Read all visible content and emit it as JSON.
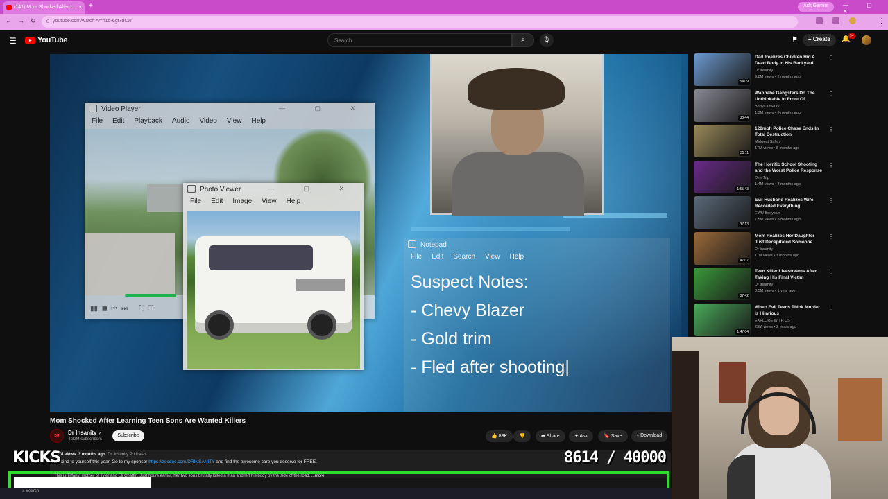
{
  "browser": {
    "tab_title": "(141) Mom Shocked After L...",
    "tab_close": "×",
    "new_tab": "+",
    "url": "youtube.com/watch?v=n15-6gt7dCw",
    "gemini_label": "Ask Gemini",
    "window_controls": "— ▢ ✕"
  },
  "header": {
    "logo_text": "YouTube",
    "search_placeholder": "Search",
    "create_label": "+ Create",
    "notif_count": "9+"
  },
  "video_overlay": {
    "video_player": {
      "title": "Video Player",
      "menu": [
        "File",
        "Edit",
        "Playback",
        "Audio",
        "Video",
        "View",
        "Help"
      ]
    },
    "photo_viewer": {
      "title": "Photo Viewer",
      "menu": [
        "File",
        "Edit",
        "Image",
        "View",
        "Help"
      ]
    },
    "notepad": {
      "title": "Notepad",
      "menu": [
        "File",
        "Edit",
        "Search",
        "View",
        "Help"
      ],
      "lines": [
        "Suspect Notes:",
        "- Chevy Blazer",
        "- Gold trim",
        "- Fled after shooting|"
      ]
    }
  },
  "video": {
    "title": "Mom Shocked After Learning Teen Sons Are Wanted Killers",
    "channel": "Dr Insanity",
    "channel_badge": "DR",
    "subscribers": "4.32M subscribers",
    "subscribe_label": "Subscribe",
    "likes": "83K",
    "share_label": "Share",
    "ask_label": "Ask",
    "save_label": "Save",
    "download_label": "Download"
  },
  "description": {
    "meta_views": "7.1M views",
    "meta_age": "3 months ago",
    "meta_tag": "Dr. Insanity Podcasts",
    "line2_text": "Be kind to yourself this year. Go to my sponsor",
    "line2_link": "https://zocdoc.com/DRINSANITY",
    "line2_tail": "and find the awesome care you deserve for FREE.",
    "line3": "This is Tiffany, mother of Tyler and Eli Chaffin. Just hours earlier, her two sons brutally killed a man and left his body by the side of the road.",
    "more": "...more"
  },
  "stream_overlay": {
    "kicks_label": "KICKS",
    "goal_counter": "8614 / 40000"
  },
  "taskbar": {
    "search_text": "Search"
  },
  "recommendations": [
    {
      "title": "Dad Realizes Children Hid A Dead Body In His Backyard",
      "channel": "Dr Insanity",
      "meta": "9.8M views • 2 months ago",
      "duration": "54:09",
      "color": "#6d9bd1"
    },
    {
      "title": "Wannabe Gangsters Do The Unthinkable In Front Of ...",
      "channel": "BodyCamPOV",
      "meta": "1.3M views • 3 months ago",
      "duration": "38:44",
      "color": "#8a8a96"
    },
    {
      "title": "128mph Police Chase Ends In Total Destruction",
      "channel": "Midwest Safety",
      "meta": "17M views • 8 months ago",
      "duration": "35:11",
      "color": "#9a8a5a"
    },
    {
      "title": "The Horrific School Shooting and the Worst Police Response",
      "channel": "Dire Trip",
      "meta": "1.4M views • 3 months ago",
      "duration": "1:55:43",
      "color": "#6a2a8a"
    },
    {
      "title": "Evil Husband Realizes Wife Recorded Everything",
      "channel": "EWU Bodycam",
      "meta": "7.5M views • 3 months ago",
      "duration": "37:13",
      "color": "#5a6a7a"
    },
    {
      "title": "Mom Realizes Her Daughter Just Decapitated Someone",
      "channel": "Dr Insanity",
      "meta": "11M views • 3 months ago",
      "duration": "47:07",
      "color": "#9a6a3a"
    },
    {
      "title": "Teen Killer Livestreams After Taking His Final Victim",
      "channel": "Dr Insanity",
      "meta": "8.5M views • 1 year ago",
      "duration": "37:42",
      "color": "#3a9a3a"
    },
    {
      "title": "When Evil Teens Think Murder is Hilarious",
      "channel": "EXPLORE WITH US",
      "meta": "23M views • 2 years ago",
      "duration": "1:47:04",
      "color": "#4aaa5a"
    }
  ],
  "colors": {
    "browser_accent": "#c94bc9",
    "youtube_red": "#ff0000",
    "overlay_green": "#2de02d",
    "link_blue": "#3ea6ff"
  }
}
